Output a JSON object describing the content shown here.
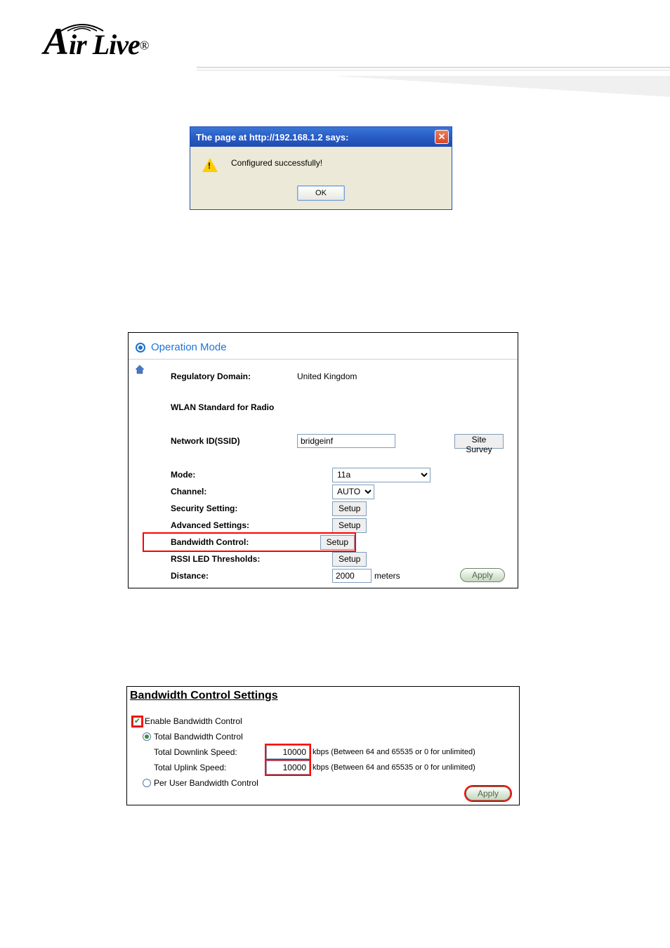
{
  "logo": {
    "text": "Air Live",
    "registered": "®"
  },
  "dialog": {
    "title": "The page at http://192.168.1.2 says:",
    "message": "Configured successfully!",
    "ok": "OK"
  },
  "op": {
    "title": "Operation Mode",
    "regulatory_label": "Regulatory Domain:",
    "regulatory_value": "United Kingdom",
    "wlan_label": "WLAN Standard for Radio",
    "ssid_label": "Network ID(SSID)",
    "ssid_value": "bridgeinf",
    "site_survey": "Site Survey",
    "mode_label": "Mode:",
    "mode_value": "11a",
    "channel_label": "Channel:",
    "channel_value": "AUTO",
    "security_label": "Security Setting:",
    "security_btn": "Setup",
    "advanced_label": "Advanced Settings:",
    "advanced_btn": "Setup",
    "bandwidth_label": "Bandwidth Control:",
    "bandwidth_btn": "Setup",
    "rssi_label": "RSSI LED Thresholds:",
    "rssi_btn": "Setup",
    "distance_label": "Distance:",
    "distance_value": "2000",
    "distance_unit": "meters",
    "apply": "Apply"
  },
  "bw": {
    "title": "Bandwidth Control Settings",
    "enable": "Enable Bandwidth Control",
    "total": "Total Bandwidth Control",
    "downlink_label": "Total Downlink Speed:",
    "downlink_value": "10000",
    "uplink_label": "Total Uplink Speed:",
    "uplink_value": "10000",
    "hint": "kbps (Between 64 and 65535 or 0 for unlimited)",
    "peruser": "Per User Bandwidth Control",
    "apply": "Apply"
  }
}
